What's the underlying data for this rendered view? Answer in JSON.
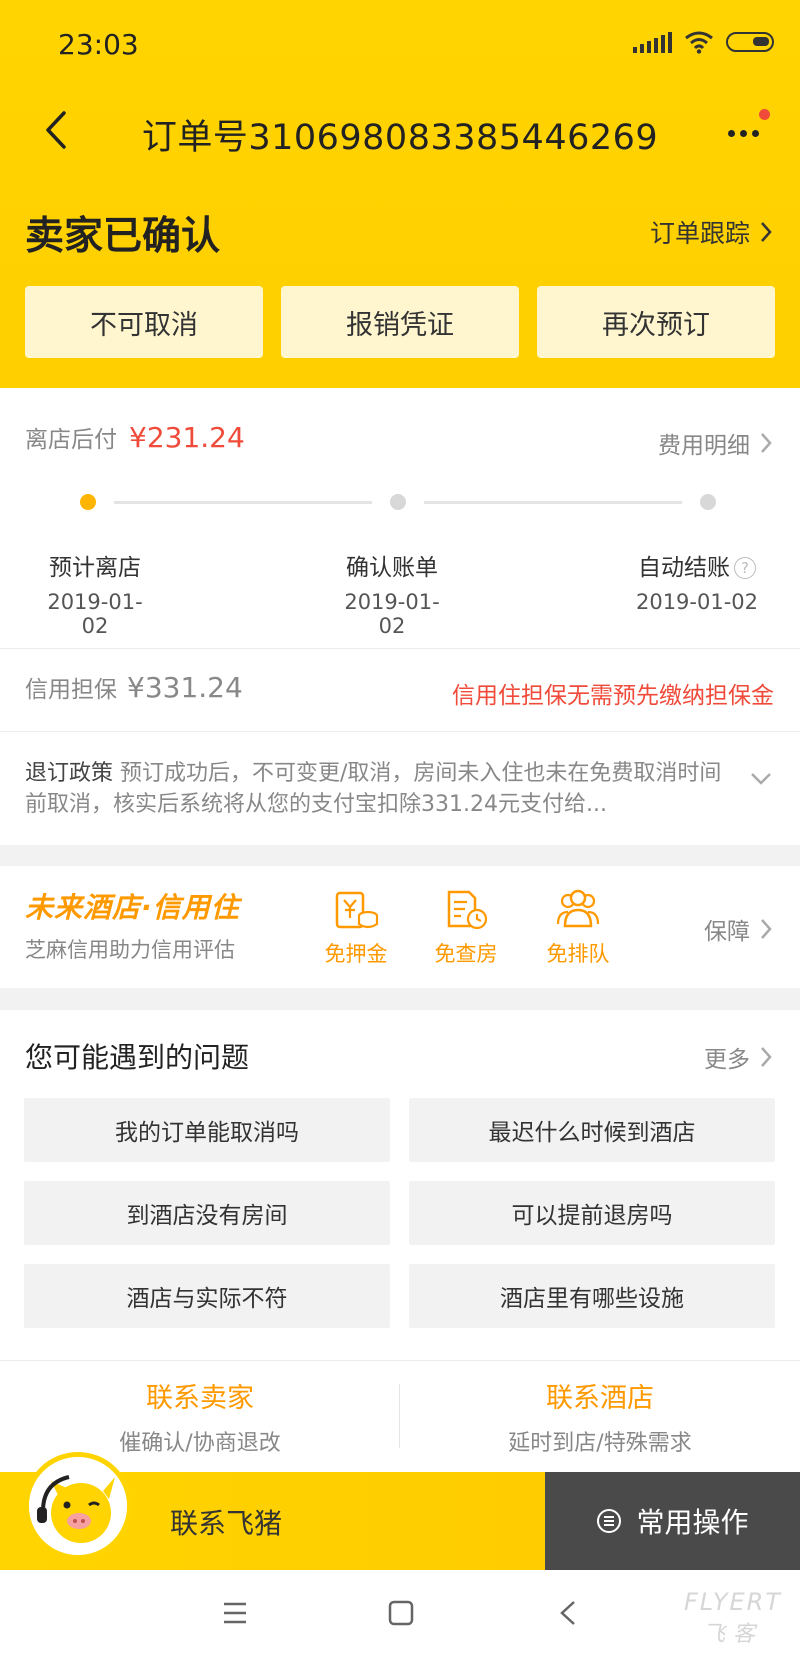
{
  "status_bar": {
    "time": "23:03"
  },
  "nav": {
    "title": "订单号3106980833854462​69"
  },
  "order": {
    "status": "卖家已确认",
    "track_label": "订单跟踪",
    "actions": [
      "不可取消",
      "报销凭证",
      "再次预订"
    ]
  },
  "payment": {
    "label": "离店后付",
    "amount": "¥231.24",
    "detail_label": "费用明细",
    "steps": [
      {
        "label": "预计离店",
        "date": "2019-01-02"
      },
      {
        "label": "确认账单",
        "date": "2019-01-02"
      },
      {
        "label": "自动结账",
        "date": "2019-01-02"
      }
    ],
    "help_glyph": "?"
  },
  "guarantee": {
    "label": "信用担保",
    "amount": "¥331.24",
    "note": "信用住担保无需预先缴纳担保金"
  },
  "policy": {
    "title": "退订政策",
    "text": "预订成功后，不可变更/取消，房间未入住也未在免费取消时间前取消，核实后系统将从您的支付宝扣除331.24元支付给..."
  },
  "credit": {
    "logo": "未来酒店·信用住",
    "subtitle": "芝麻信用助力信用评估",
    "perks": [
      {
        "label": "免押金",
        "icon": "deposit-free-icon"
      },
      {
        "label": "免查房",
        "icon": "no-room-check-icon"
      },
      {
        "label": "免排队",
        "icon": "no-queue-icon"
      }
    ],
    "guard_label": "保障"
  },
  "faq": {
    "title": "您可能遇到的问题",
    "more_label": "更多",
    "items": [
      "我的订单能取消吗",
      "最迟什么时候到酒店",
      "到酒店没有房间",
      "可以提前退房吗",
      "酒店与实际不符",
      "酒店里有哪些设施"
    ]
  },
  "contacts": [
    {
      "title": "联系卖家",
      "subtitle": "催确认/协商退改"
    },
    {
      "title": "联系酒店",
      "subtitle": "延时到店/特殊需求"
    }
  ],
  "bottom": {
    "fliggy_label": "联系飞猪",
    "ops_label": "常用操作"
  },
  "watermark": {
    "line1": "FLYERT",
    "line2": "飞客"
  },
  "colors": {
    "brand_yellow": "#ffd400",
    "accent_orange": "#ff9900",
    "price_red": "#f04b3a"
  }
}
